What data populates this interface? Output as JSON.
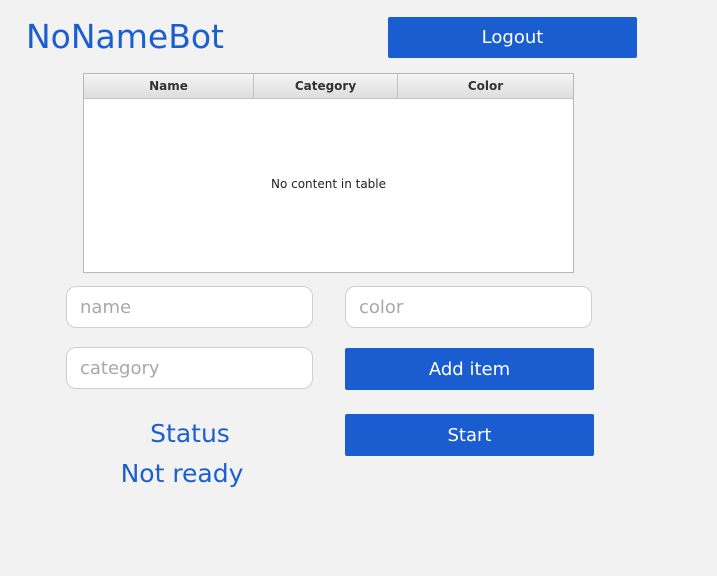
{
  "app": {
    "title": "NoNameBot"
  },
  "header": {
    "logout_label": "Logout"
  },
  "table": {
    "columns": [
      "Name",
      "Category",
      "Color"
    ],
    "empty_message": "No content in table"
  },
  "form": {
    "name_placeholder": "name",
    "color_placeholder": "color",
    "category_placeholder": "category",
    "add_label": "Add item",
    "start_label": "Start"
  },
  "status": {
    "label": "Status",
    "value": "Not ready"
  },
  "colors": {
    "accent": "#1a5dd0",
    "background": "#f2f2f3"
  }
}
